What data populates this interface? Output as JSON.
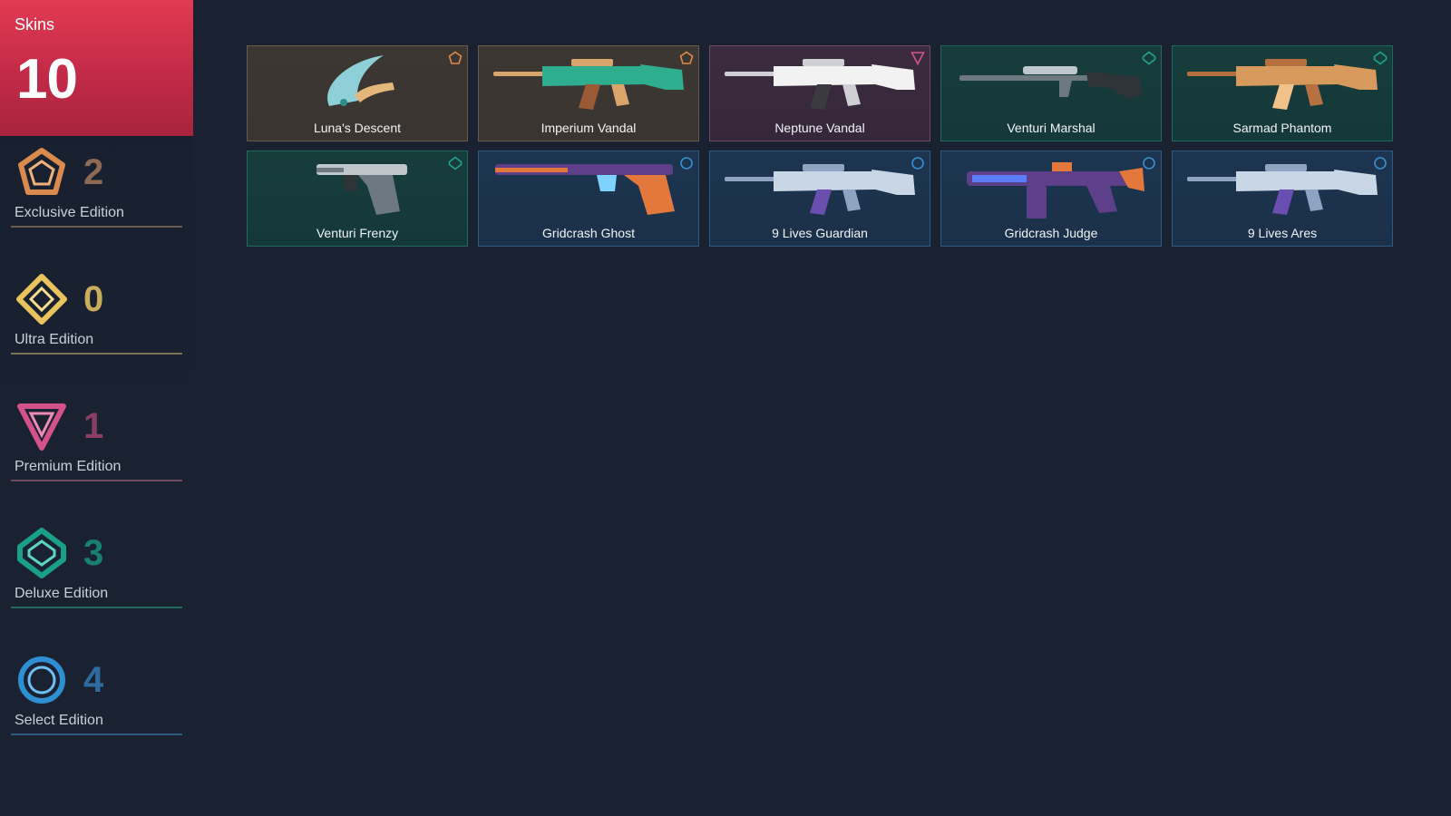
{
  "summary": {
    "label": "Skins",
    "total": "10"
  },
  "colors": {
    "exclusive": "#e08a4a",
    "ultra": "#f1d165",
    "premium": "#d6548a",
    "deluxe": "#1fa58f",
    "select": "#3a8fd1",
    "summary_bg": "#d23349"
  },
  "tiers": [
    {
      "label": "Exclusive Edition",
      "count": "2",
      "icon": "exclusive-pentagon-icon"
    },
    {
      "label": "Ultra Edition",
      "count": "0",
      "icon": "ultra-diamond-icon"
    },
    {
      "label": "Premium Edition",
      "count": "1",
      "icon": "premium-triangle-icon"
    },
    {
      "label": "Deluxe Edition",
      "count": "3",
      "icon": "deluxe-hexagon-icon"
    },
    {
      "label": "Select Edition",
      "count": "4",
      "icon": "select-circle-icon"
    }
  ],
  "skins": [
    {
      "name": "Luna's Descent",
      "tier": "exclusive",
      "art": "knife"
    },
    {
      "name": "Imperium Vandal",
      "tier": "exclusive",
      "art": "rifle"
    },
    {
      "name": "Neptune Vandal",
      "tier": "premium",
      "art": "rifle"
    },
    {
      "name": "Venturi Marshal",
      "tier": "deluxe",
      "art": "sniper"
    },
    {
      "name": "Sarmad Phantom",
      "tier": "deluxe",
      "art": "rifle"
    },
    {
      "name": "Venturi Frenzy",
      "tier": "deluxe",
      "art": "pistol"
    },
    {
      "name": "Gridcrash Ghost",
      "tier": "select",
      "art": "pistol-long"
    },
    {
      "name": "9 Lives Guardian",
      "tier": "select",
      "art": "rifle-long"
    },
    {
      "name": "Gridcrash Judge",
      "tier": "select",
      "art": "shotgun"
    },
    {
      "name": "9 Lives Ares",
      "tier": "select",
      "art": "lmg"
    }
  ]
}
